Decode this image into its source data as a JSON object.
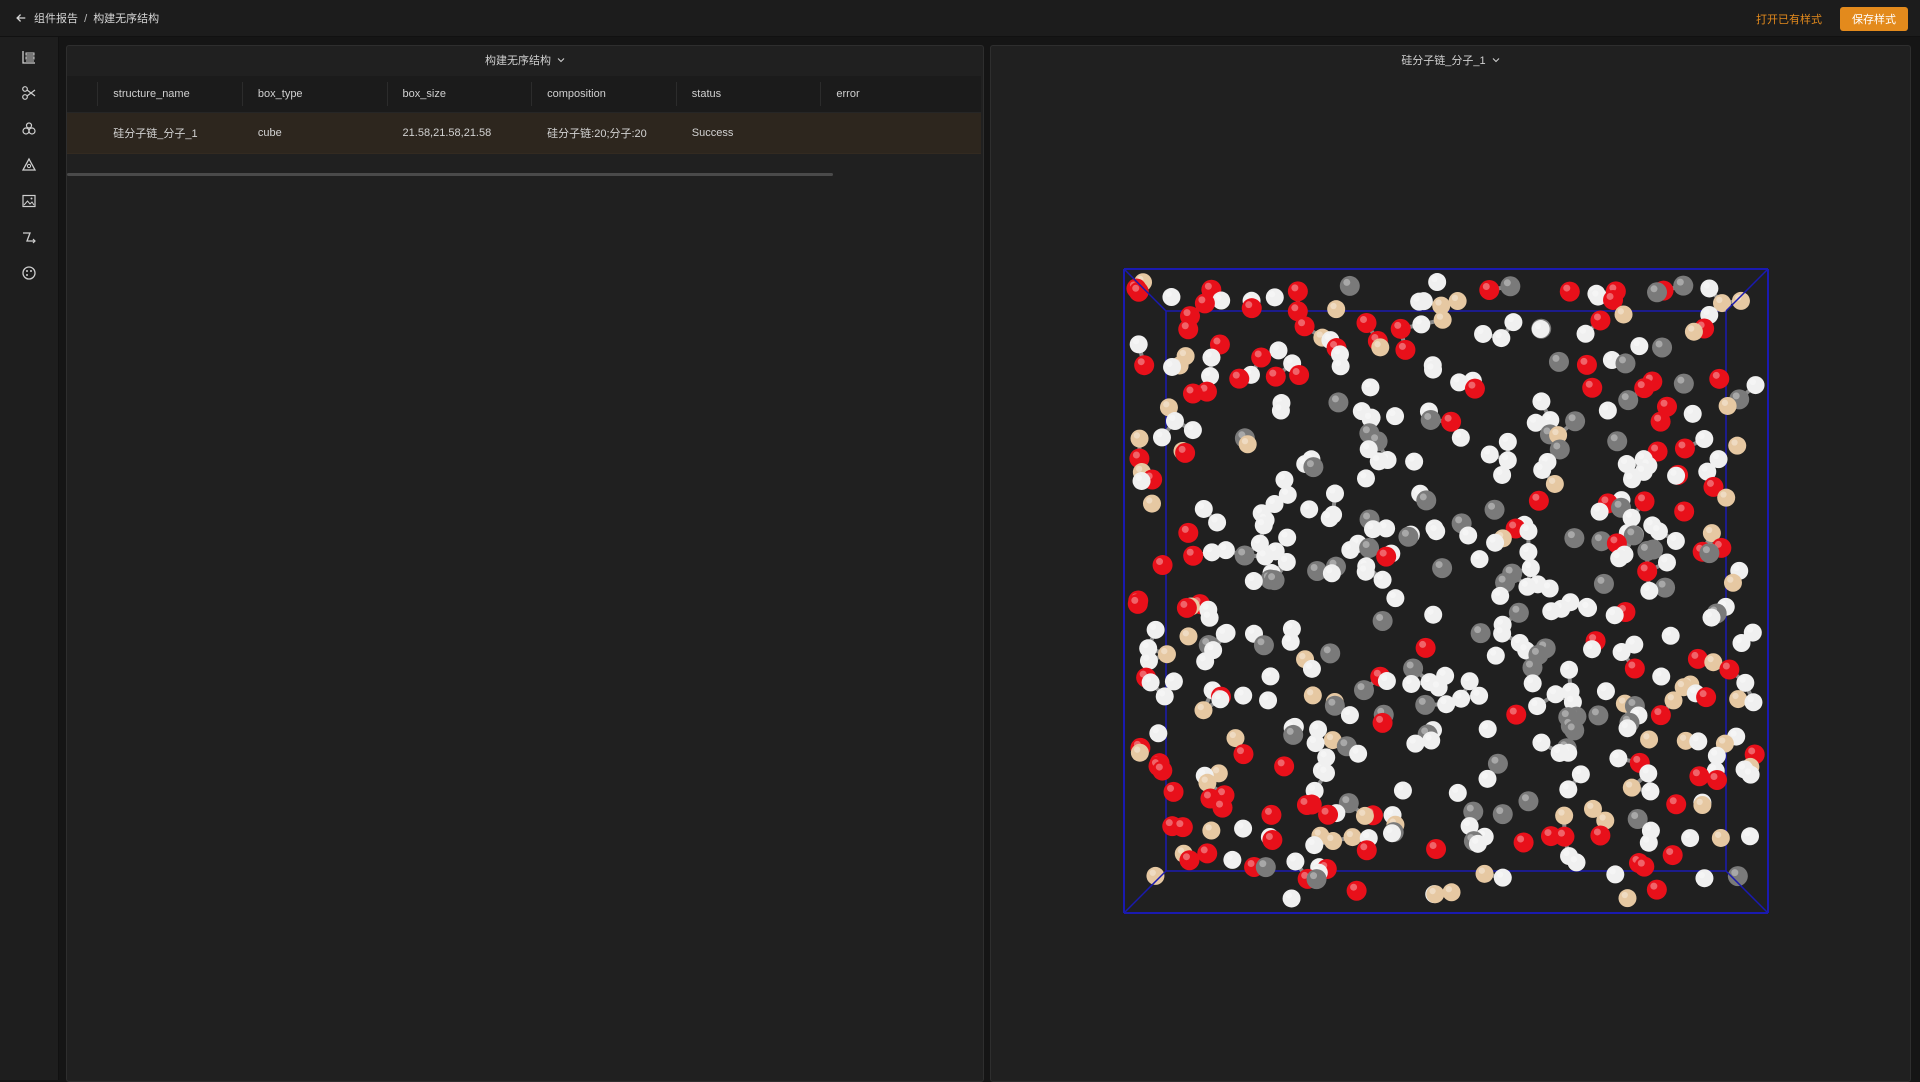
{
  "header": {
    "back_icon": "arrow-left-icon",
    "breadcrumb_parent": "组件报告",
    "breadcrumb_separator": "/",
    "breadcrumb_current": "构建无序结构",
    "open_style_label": "打开已有样式",
    "save_style_label": "保存样式",
    "accent_color": "#e38a1c"
  },
  "sidebar": {
    "items": [
      {
        "icon": "chart-icon"
      },
      {
        "icon": "scissors-icon"
      },
      {
        "icon": "molecule-icon"
      },
      {
        "icon": "triangle-nodes-icon"
      },
      {
        "icon": "image-icon"
      },
      {
        "icon": "path-icon"
      },
      {
        "icon": "palette-icon"
      }
    ]
  },
  "left_panel": {
    "title": "构建无序结构",
    "columns": [
      "structure_name",
      "box_type",
      "box_size",
      "composition",
      "status",
      "error"
    ],
    "rows": [
      {
        "structure_name": "硅分子链_分子_1",
        "box_type": "cube",
        "box_size": "21.58,21.58,21.58",
        "composition": "硅分子链:20;分子:20",
        "status": "Success",
        "error": ""
      }
    ]
  },
  "right_panel": {
    "title": "硅分子链_分子_1",
    "viewer": {
      "box_color": "#1a1ab0",
      "atom_colors": {
        "oxygen": "#e8101a",
        "hydrogen": "#f0f0f0",
        "carbon": "#7a7a7a",
        "silicon": "#e6c8a2"
      }
    }
  }
}
